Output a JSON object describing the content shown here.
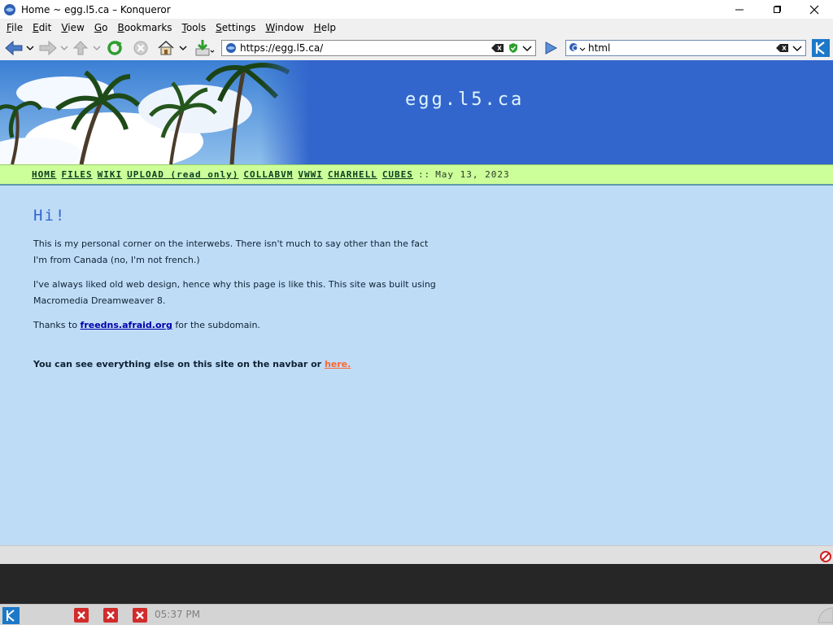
{
  "window": {
    "title": "Home ~ egg.l5.ca – Konqueror"
  },
  "menubar": {
    "items": [
      {
        "first": "F",
        "rest": "ile"
      },
      {
        "first": "E",
        "rest": "dit"
      },
      {
        "first": "V",
        "rest": "iew"
      },
      {
        "first": "G",
        "rest": "o"
      },
      {
        "first": "B",
        "rest": "ookmarks"
      },
      {
        "first": "T",
        "rest": "ools"
      },
      {
        "first": "S",
        "rest": "ettings"
      },
      {
        "first": "W",
        "rest": "indow"
      },
      {
        "first": "H",
        "rest": "elp"
      }
    ]
  },
  "toolbar": {
    "url": "https://egg.l5.ca/",
    "search_query": "html"
  },
  "page": {
    "site_title": "egg.l5.ca",
    "nav": [
      "HOME",
      "FILES",
      "WIKI",
      "UPLOAD (read only)",
      "COLLABVM",
      "VWWI",
      "CHARHELL",
      "CUBES"
    ],
    "nav_sep": "::",
    "date": "May 13, 2023",
    "heading": "Hi!",
    "para1": "This is my personal corner on the interwebs. There isn't much to say other than the fact I'm from Canada (no, I'm not french.)",
    "para2": "I've always liked old web design, hence why this page is like this. This site was built using Macromedia Dreamweaver 8.",
    "thanks_prefix": "Thanks to",
    "thanks_link": "freedns.afraid.org",
    "thanks_suffix": "for the subdomain.",
    "navbar_note": "You can see everything else on this site on the navbar or",
    "navbar_note_link": "here."
  },
  "taskbar": {
    "clock": "05:37 PM"
  },
  "colors": {
    "banner_blue": "#3366cc",
    "page_bg": "#bfdcf7",
    "navbar_green": "#ccff99",
    "link_orange": "#ff6633",
    "heading_blue": "#3366cc"
  }
}
